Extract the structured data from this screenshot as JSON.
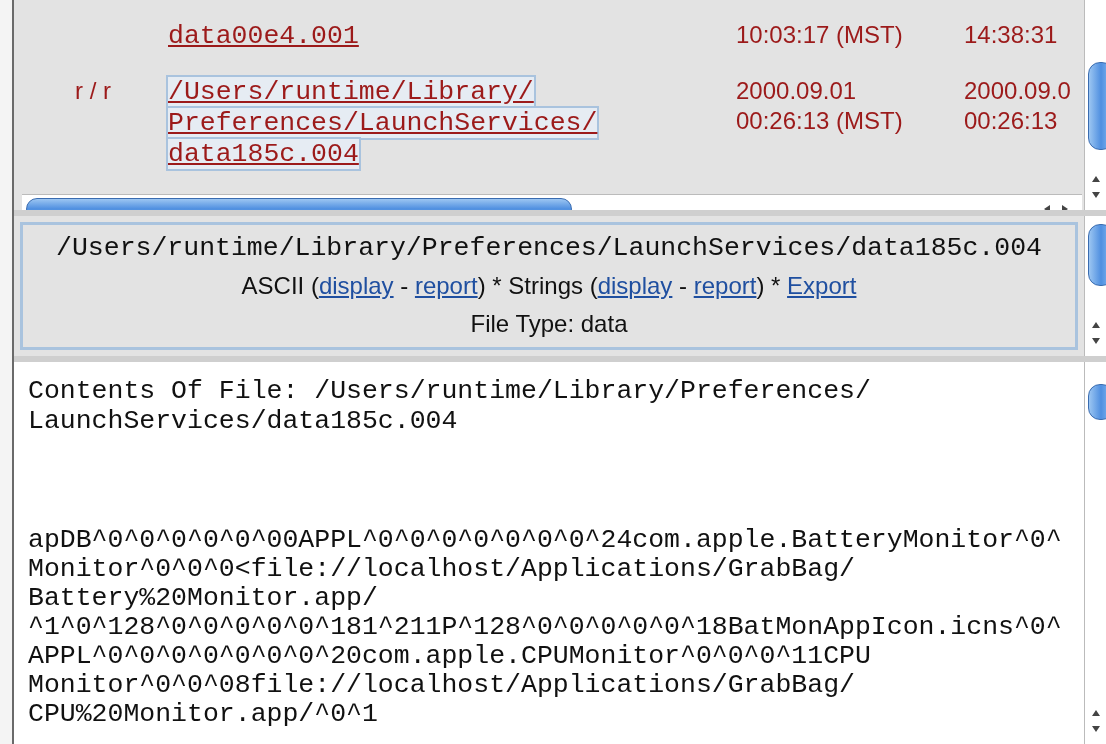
{
  "file_list": {
    "rows": [
      {
        "name_lines": [
          "data00e4.001"
        ],
        "selected": false,
        "column_3": [
          "10:03:17 (MST)"
        ],
        "column_4": [
          "14:38:31"
        ]
      },
      {
        "permissions": "r / r",
        "name_lines": [
          "/Users/runtime/Library/",
          "Preferences/LaunchServices/",
          "data185c.004"
        ],
        "selected": true,
        "column_3": [
          "2000.09.01",
          "00:26:13 (MST)"
        ],
        "column_4": [
          "2000.09.0",
          "00:26:13"
        ]
      }
    ]
  },
  "file_details": {
    "path": "/Users/runtime/Library/Preferences/LaunchServices/data185c.004",
    "view_options": [
      {
        "kind": "text",
        "text": "ASCII ("
      },
      {
        "kind": "link",
        "text": "display"
      },
      {
        "kind": "text",
        "text": " - "
      },
      {
        "kind": "link",
        "text": "report"
      },
      {
        "kind": "text",
        "text": ") * Strings ("
      },
      {
        "kind": "link",
        "text": "display"
      },
      {
        "kind": "text",
        "text": " - "
      },
      {
        "kind": "link",
        "text": "report"
      },
      {
        "kind": "text",
        "text": ") * "
      },
      {
        "kind": "link",
        "text": "Export"
      }
    ],
    "file_type": "File Type: data"
  },
  "contents": {
    "header_lines": [
      "Contents Of File: /Users/runtime/Library/Preferences/",
      "LaunchServices/data185c.004"
    ],
    "data_lines": [
      "apDB^0^0^0^0^0^00APPL^0^0^0^0^0^0^0^24com.apple.BatteryMonitor^0^",
      "Monitor^0^0^0<file://localhost/Applications/GrabBag/",
      "Battery%20Monitor.app/",
      "^1^0^128^0^0^0^0^0^181^211P^128^0^0^0^0^0^18BatMonAppIcon.icns^0^",
      "APPL^0^0^0^0^0^0^0^20com.apple.CPUMonitor^0^0^0^11CPU",
      "Monitor^0^0^08file://localhost/Applications/GrabBag/",
      "CPU%20Monitor.app/^0^1"
    ]
  }
}
